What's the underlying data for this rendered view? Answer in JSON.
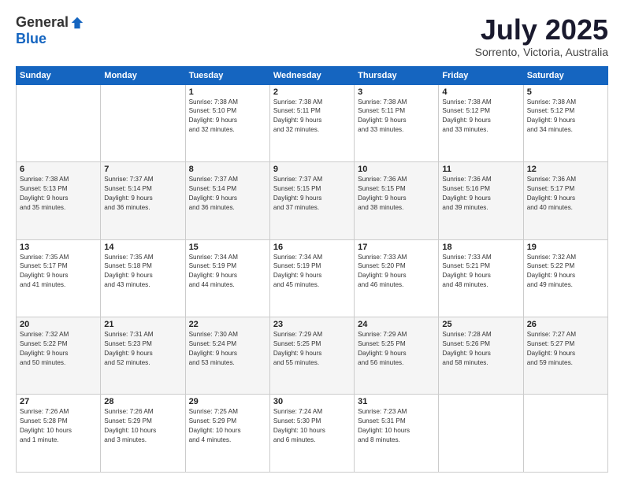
{
  "logo": {
    "general": "General",
    "blue": "Blue"
  },
  "header": {
    "title": "July 2025",
    "subtitle": "Sorrento, Victoria, Australia"
  },
  "weekdays": [
    "Sunday",
    "Monday",
    "Tuesday",
    "Wednesday",
    "Thursday",
    "Friday",
    "Saturday"
  ],
  "weeks": [
    [
      {
        "day": "",
        "info": ""
      },
      {
        "day": "",
        "info": ""
      },
      {
        "day": "1",
        "info": "Sunrise: 7:38 AM\nSunset: 5:10 PM\nDaylight: 9 hours\nand 32 minutes."
      },
      {
        "day": "2",
        "info": "Sunrise: 7:38 AM\nSunset: 5:11 PM\nDaylight: 9 hours\nand 32 minutes."
      },
      {
        "day": "3",
        "info": "Sunrise: 7:38 AM\nSunset: 5:11 PM\nDaylight: 9 hours\nand 33 minutes."
      },
      {
        "day": "4",
        "info": "Sunrise: 7:38 AM\nSunset: 5:12 PM\nDaylight: 9 hours\nand 33 minutes."
      },
      {
        "day": "5",
        "info": "Sunrise: 7:38 AM\nSunset: 5:12 PM\nDaylight: 9 hours\nand 34 minutes."
      }
    ],
    [
      {
        "day": "6",
        "info": "Sunrise: 7:38 AM\nSunset: 5:13 PM\nDaylight: 9 hours\nand 35 minutes."
      },
      {
        "day": "7",
        "info": "Sunrise: 7:37 AM\nSunset: 5:14 PM\nDaylight: 9 hours\nand 36 minutes."
      },
      {
        "day": "8",
        "info": "Sunrise: 7:37 AM\nSunset: 5:14 PM\nDaylight: 9 hours\nand 36 minutes."
      },
      {
        "day": "9",
        "info": "Sunrise: 7:37 AM\nSunset: 5:15 PM\nDaylight: 9 hours\nand 37 minutes."
      },
      {
        "day": "10",
        "info": "Sunrise: 7:36 AM\nSunset: 5:15 PM\nDaylight: 9 hours\nand 38 minutes."
      },
      {
        "day": "11",
        "info": "Sunrise: 7:36 AM\nSunset: 5:16 PM\nDaylight: 9 hours\nand 39 minutes."
      },
      {
        "day": "12",
        "info": "Sunrise: 7:36 AM\nSunset: 5:17 PM\nDaylight: 9 hours\nand 40 minutes."
      }
    ],
    [
      {
        "day": "13",
        "info": "Sunrise: 7:35 AM\nSunset: 5:17 PM\nDaylight: 9 hours\nand 41 minutes."
      },
      {
        "day": "14",
        "info": "Sunrise: 7:35 AM\nSunset: 5:18 PM\nDaylight: 9 hours\nand 43 minutes."
      },
      {
        "day": "15",
        "info": "Sunrise: 7:34 AM\nSunset: 5:19 PM\nDaylight: 9 hours\nand 44 minutes."
      },
      {
        "day": "16",
        "info": "Sunrise: 7:34 AM\nSunset: 5:19 PM\nDaylight: 9 hours\nand 45 minutes."
      },
      {
        "day": "17",
        "info": "Sunrise: 7:33 AM\nSunset: 5:20 PM\nDaylight: 9 hours\nand 46 minutes."
      },
      {
        "day": "18",
        "info": "Sunrise: 7:33 AM\nSunset: 5:21 PM\nDaylight: 9 hours\nand 48 minutes."
      },
      {
        "day": "19",
        "info": "Sunrise: 7:32 AM\nSunset: 5:22 PM\nDaylight: 9 hours\nand 49 minutes."
      }
    ],
    [
      {
        "day": "20",
        "info": "Sunrise: 7:32 AM\nSunset: 5:22 PM\nDaylight: 9 hours\nand 50 minutes."
      },
      {
        "day": "21",
        "info": "Sunrise: 7:31 AM\nSunset: 5:23 PM\nDaylight: 9 hours\nand 52 minutes."
      },
      {
        "day": "22",
        "info": "Sunrise: 7:30 AM\nSunset: 5:24 PM\nDaylight: 9 hours\nand 53 minutes."
      },
      {
        "day": "23",
        "info": "Sunrise: 7:29 AM\nSunset: 5:25 PM\nDaylight: 9 hours\nand 55 minutes."
      },
      {
        "day": "24",
        "info": "Sunrise: 7:29 AM\nSunset: 5:25 PM\nDaylight: 9 hours\nand 56 minutes."
      },
      {
        "day": "25",
        "info": "Sunrise: 7:28 AM\nSunset: 5:26 PM\nDaylight: 9 hours\nand 58 minutes."
      },
      {
        "day": "26",
        "info": "Sunrise: 7:27 AM\nSunset: 5:27 PM\nDaylight: 9 hours\nand 59 minutes."
      }
    ],
    [
      {
        "day": "27",
        "info": "Sunrise: 7:26 AM\nSunset: 5:28 PM\nDaylight: 10 hours\nand 1 minute."
      },
      {
        "day": "28",
        "info": "Sunrise: 7:26 AM\nSunset: 5:29 PM\nDaylight: 10 hours\nand 3 minutes."
      },
      {
        "day": "29",
        "info": "Sunrise: 7:25 AM\nSunset: 5:29 PM\nDaylight: 10 hours\nand 4 minutes."
      },
      {
        "day": "30",
        "info": "Sunrise: 7:24 AM\nSunset: 5:30 PM\nDaylight: 10 hours\nand 6 minutes."
      },
      {
        "day": "31",
        "info": "Sunrise: 7:23 AM\nSunset: 5:31 PM\nDaylight: 10 hours\nand 8 minutes."
      },
      {
        "day": "",
        "info": ""
      },
      {
        "day": "",
        "info": ""
      }
    ]
  ]
}
